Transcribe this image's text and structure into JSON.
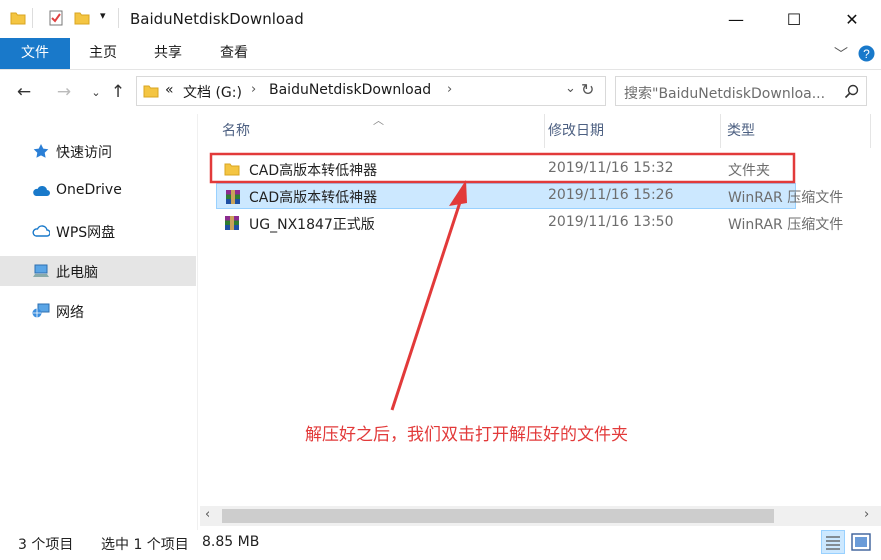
{
  "window": {
    "title": "BaiduNetdiskDownload",
    "controls": {
      "minimize": "—",
      "maximize": "☐",
      "close": "✕"
    }
  },
  "ribbon": {
    "tabs": [
      {
        "label": "文件",
        "active": true
      },
      {
        "label": "主页",
        "active": false
      },
      {
        "label": "共享",
        "active": false
      },
      {
        "label": "查看",
        "active": false
      }
    ],
    "collapse_icon": "chevron-down-icon",
    "help_icon": "help-icon"
  },
  "address": {
    "overflow": "«",
    "segments": [
      "文档 (G:)",
      "BaiduNetdiskDownload"
    ],
    "search_placeholder": "搜索\"BaiduNetdiskDownloa..."
  },
  "sidebar": {
    "items": [
      {
        "label": "快速访问",
        "icon": "star-icon",
        "selected": false
      },
      {
        "label": "OneDrive",
        "icon": "cloud-icon",
        "selected": false
      },
      {
        "label": "WPS网盘",
        "icon": "cloud-outline-icon",
        "selected": false
      },
      {
        "label": "此电脑",
        "icon": "computer-icon",
        "selected": true
      },
      {
        "label": "网络",
        "icon": "network-icon",
        "selected": false
      }
    ]
  },
  "columns": {
    "name": "名称",
    "date": "修改日期",
    "type": "类型"
  },
  "files": [
    {
      "name": "CAD高版本转低神器",
      "date": "2019/11/16 15:32",
      "type": "文件夹",
      "icon": "folder-icon",
      "selected": false,
      "highlighted": true
    },
    {
      "name": "CAD高版本转低神器",
      "date": "2019/11/16 15:26",
      "type": "WinRAR 压缩文件",
      "icon": "winrar-icon",
      "selected": true,
      "highlighted": false
    },
    {
      "name": "UG_NX1847正式版",
      "date": "2019/11/16 13:50",
      "type": "WinRAR 压缩文件",
      "icon": "winrar-icon",
      "selected": false,
      "highlighted": false
    }
  ],
  "annotation": "解压好之后，我们双击打开解压好的文件夹",
  "status": {
    "count": "3 个项目",
    "selection": "选中 1 个项目",
    "size": "8.85 MB"
  },
  "colors": {
    "accent": "#1979ca",
    "selection": "#cce8ff",
    "annotation": "#e23a3a"
  }
}
